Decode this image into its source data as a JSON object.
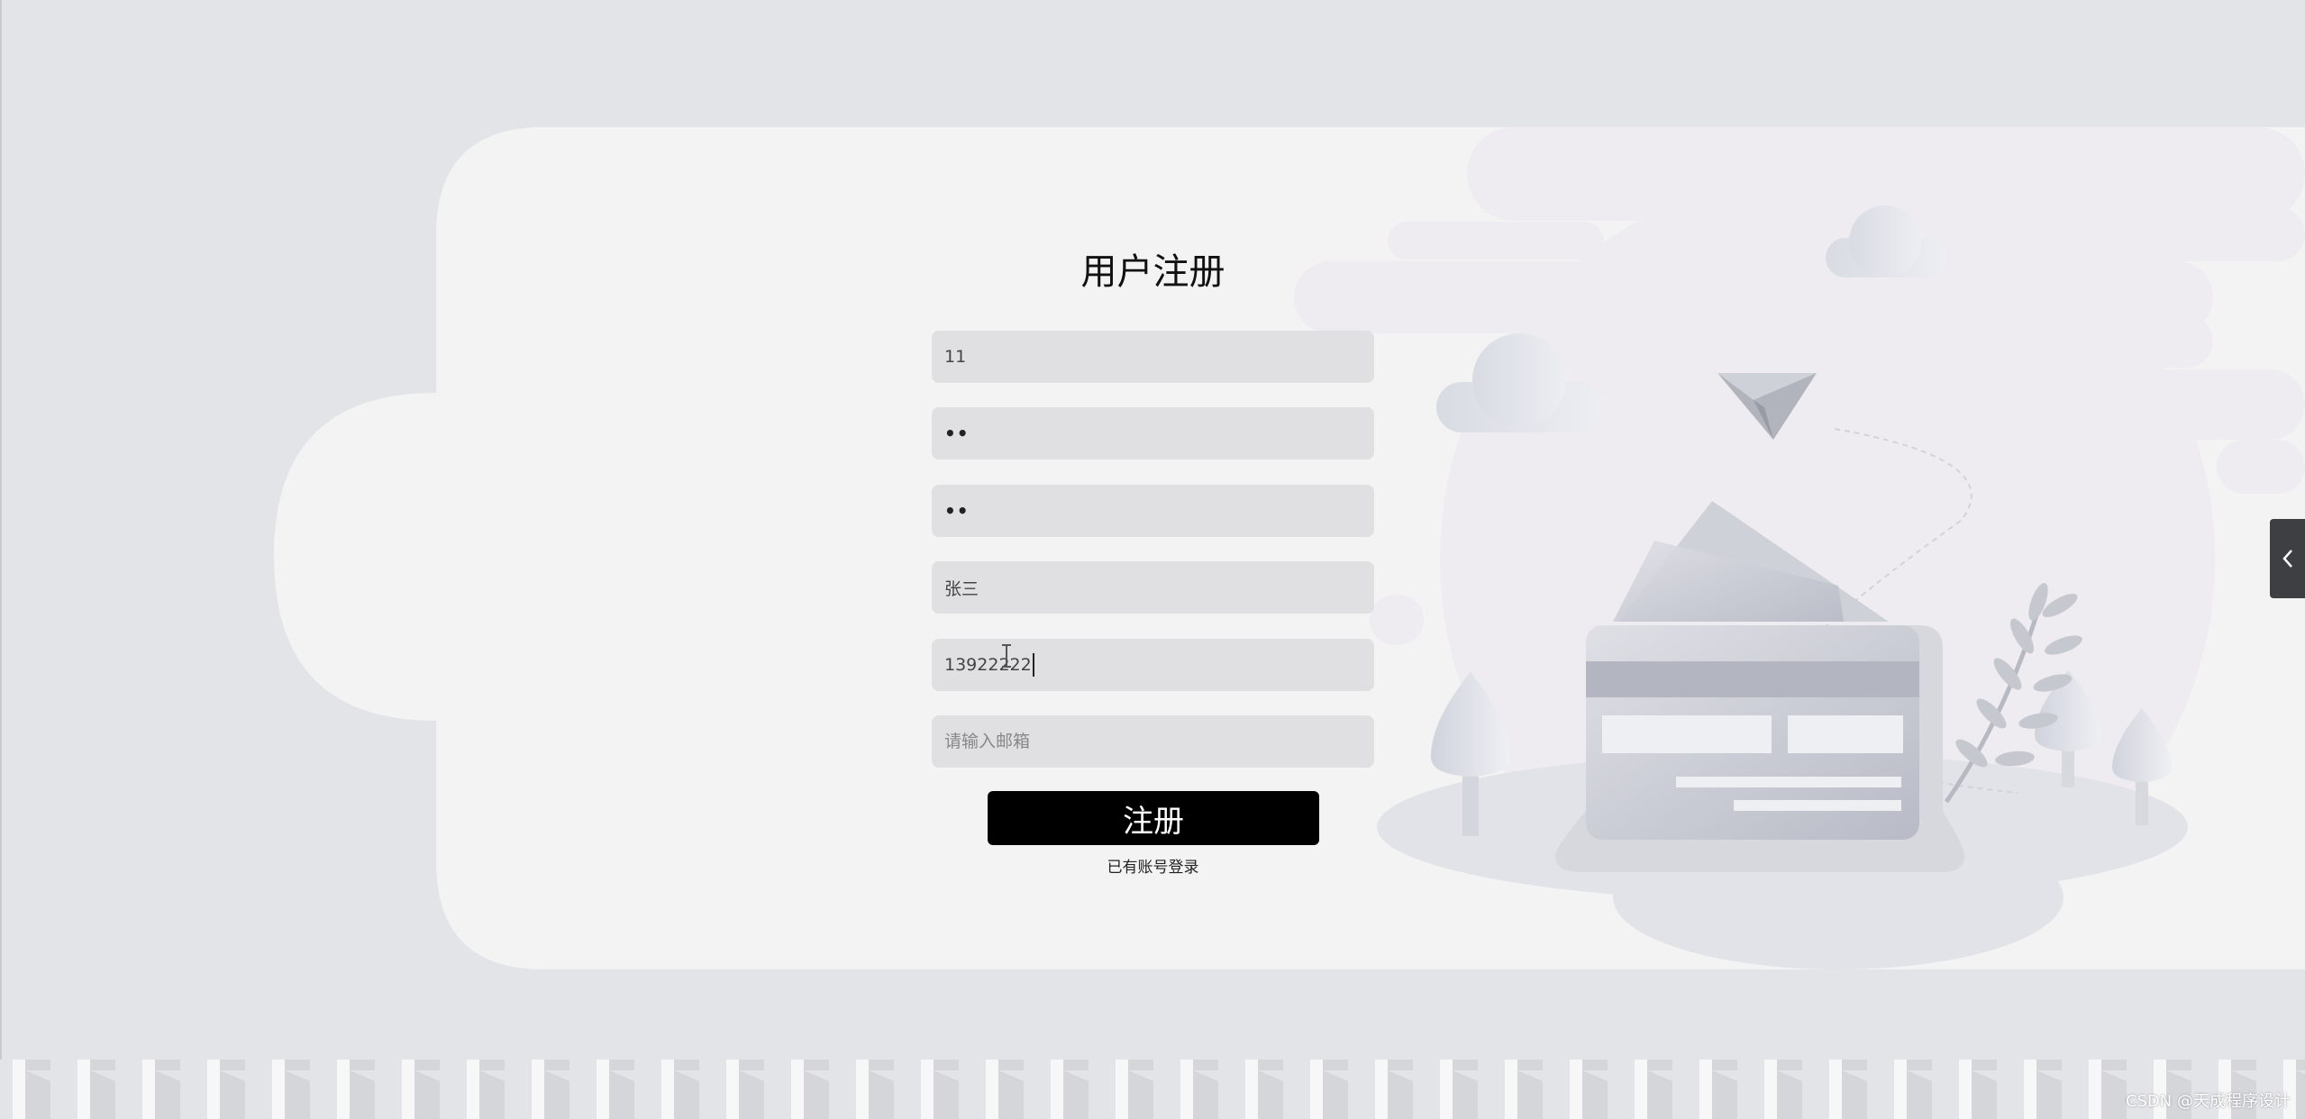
{
  "form": {
    "title": "用户注册",
    "username_value": "11",
    "password_value": "••",
    "confirm_password_value": "••",
    "name_value": "张三",
    "phone_value": "13922222",
    "email_placeholder": "请输入邮箱",
    "submit_label": "注册",
    "login_link_label": "已有账号登录"
  },
  "side_toggle": {
    "icon": "chevron-left-icon",
    "glyph": "‹"
  },
  "watermark": "CSDN @天成程序设计",
  "colors": {
    "page_bg": "#e3e4e8",
    "card_bg": "#f3f3f3",
    "field_bg": "#e0dfe1",
    "button_bg": "#000000"
  }
}
